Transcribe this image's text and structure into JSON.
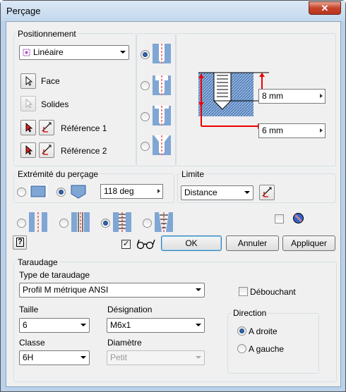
{
  "window": {
    "title": "Perçage",
    "close_glyph": "✕"
  },
  "positionnement": {
    "group_label": "Positionnement",
    "type_combo": "Linéaire",
    "face_label": "Face",
    "solides_label": "Solides",
    "reference1_label": "Référence 1",
    "reference2_label": "Référence 2"
  },
  "preview": {
    "depth_value": "8 mm",
    "diameter_value": "6 mm"
  },
  "extremite": {
    "group_label": "Extrémité du perçage",
    "angle_value": "118 deg"
  },
  "limite": {
    "group_label": "Limite",
    "type_combo": "Distance"
  },
  "buttons": {
    "ok": "OK",
    "cancel": "Annuler",
    "apply": "Appliquer",
    "help": "?"
  },
  "taraudage": {
    "group_label": "Taraudage",
    "type_label": "Type de taraudage",
    "type_value": "Profil M métrique ANSI",
    "debouchant_label": "Débouchant",
    "taille_label": "Taille",
    "taille_value": "6",
    "designation_label": "Désignation",
    "designation_value": "M6x1",
    "classe_label": "Classe",
    "classe_value": "6H",
    "diametre_label": "Diamètre",
    "diametre_value": "Petit",
    "direction_label": "Direction",
    "droite_label": "A droite",
    "gauche_label": "A gauche"
  }
}
